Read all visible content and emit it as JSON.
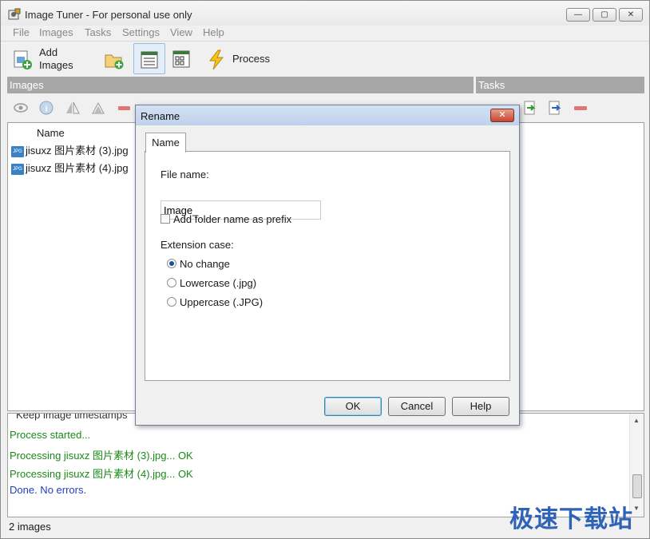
{
  "window": {
    "title": "Image Tuner - For personal use only",
    "controls": {
      "minimize": "▭",
      "maximize": "▢",
      "close": "✕"
    }
  },
  "menu": [
    "File",
    "Images",
    "Tasks",
    "Settings",
    "View",
    "Help"
  ],
  "toolbar": {
    "add_images_line1": "Add",
    "add_images_line2": "Images",
    "process": "Process"
  },
  "sections": {
    "images": "Images",
    "tasks": "Tasks"
  },
  "images": {
    "column_name": "Name",
    "files": [
      "jisuxz 图片素材 (3).jpg",
      "jisuxz 图片素材 (4).jpg"
    ],
    "file_icon_text": "JPG"
  },
  "log": {
    "partial_line": "Keep image timestamps",
    "lines": [
      {
        "text": "Process started...",
        "color": "#1a8a1a"
      },
      {
        "text": "Processing jisuxz 图片素材 (3).jpg... OK",
        "color": "#1a8a1a"
      },
      {
        "text": "Processing jisuxz 图片素材 (4).jpg... OK",
        "color": "#1a8a1a"
      },
      {
        "text": "Done. No errors.",
        "color": "#1f3fbf"
      }
    ]
  },
  "status": {
    "count": "2 images"
  },
  "dialog": {
    "title": "Rename",
    "tab": "Name",
    "file_name_label": "File name:",
    "file_name_value": "Image_",
    "prefix_label": "Add folder name as prefix",
    "prefix_checked": false,
    "extension_label": "Extension case:",
    "options": [
      "No change",
      "Lowercase (.jpg)",
      "Uppercase (.JPG)"
    ],
    "selected_option": "No change",
    "buttons": {
      "ok": "OK",
      "cancel": "Cancel",
      "help": "Help"
    }
  },
  "watermark": "极速下载站",
  "colors": {
    "section_header": "#a7a7a7",
    "log_ok": "#1a8a1a",
    "log_done": "#1f3fbf",
    "accent": "#3c7fb1"
  }
}
